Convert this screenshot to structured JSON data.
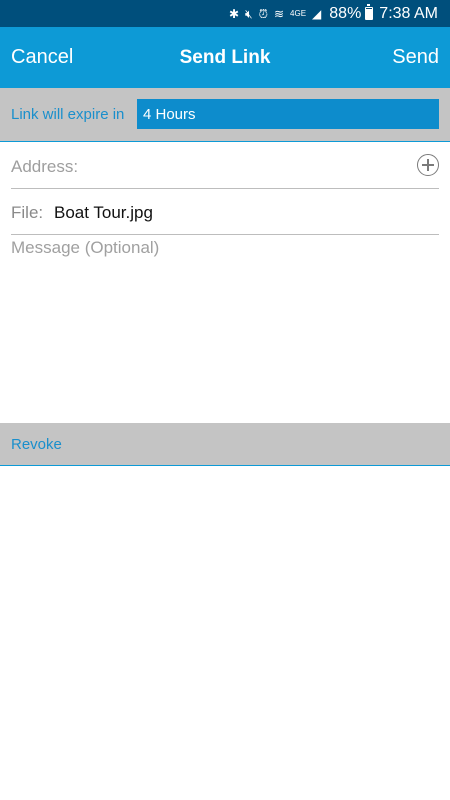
{
  "status_bar": {
    "battery_pct": "88%",
    "time": "7:38 AM",
    "icons": [
      "bluetooth-icon",
      "mute-icon",
      "alarm-icon",
      "wifi-icon",
      "lte-icon",
      "signal-icon",
      "battery-icon"
    ],
    "network_label": "4GE"
  },
  "action_bar": {
    "cancel_label": "Cancel",
    "title": "Send Link",
    "send_label": "Send"
  },
  "expire": {
    "label": "Link will expire in",
    "selected_value": "4 Hours"
  },
  "form": {
    "address_placeholder": "Address:",
    "file_label": "File:",
    "file_name": "Boat Tour.jpg",
    "message_placeholder": "Message (Optional)"
  },
  "revoke": {
    "label": "Revoke"
  },
  "colors": {
    "status_bar": "#004f7c",
    "action_bar": "#0d9ad6",
    "accent_text": "#1a8fcc",
    "gray_band": "#c4c4c4"
  }
}
